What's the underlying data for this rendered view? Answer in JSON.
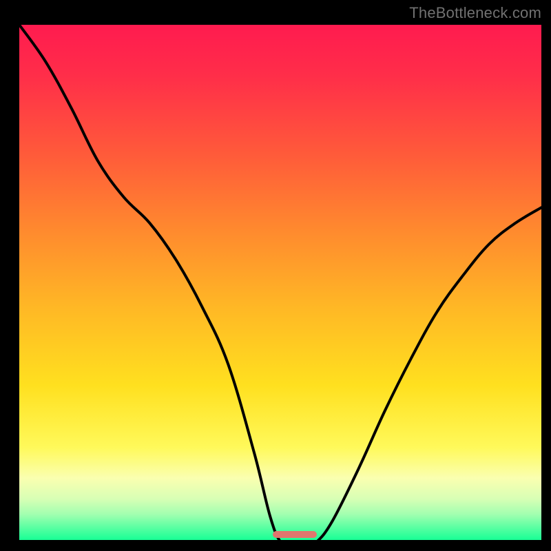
{
  "watermark": "TheBottleneck.com",
  "gradient": {
    "stops": [
      {
        "offset": "0%",
        "color": "#ff1b4f"
      },
      {
        "offset": "10%",
        "color": "#ff2e49"
      },
      {
        "offset": "25%",
        "color": "#ff5a3a"
      },
      {
        "offset": "40%",
        "color": "#ff8a2e"
      },
      {
        "offset": "55%",
        "color": "#ffb825"
      },
      {
        "offset": "70%",
        "color": "#ffe01f"
      },
      {
        "offset": "82%",
        "color": "#fff95a"
      },
      {
        "offset": "88%",
        "color": "#faffb0"
      },
      {
        "offset": "92%",
        "color": "#d8ffb5"
      },
      {
        "offset": "95%",
        "color": "#a2ffb0"
      },
      {
        "offset": "98%",
        "color": "#4effa0"
      },
      {
        "offset": "100%",
        "color": "#18ff95"
      }
    ]
  },
  "low_bar": {
    "left_pct": 48.5,
    "width_pct": 8.5,
    "color": "#e0766e"
  },
  "chart_data": {
    "type": "line",
    "title": "",
    "xlabel": "",
    "ylabel": "",
    "xlim": [
      0,
      100
    ],
    "ylim": [
      0,
      100
    ],
    "series": [
      {
        "name": "bottleneck-curve",
        "x": [
          0,
          5,
          10,
          15,
          20,
          25,
          30,
          35,
          40,
          45,
          48,
          50,
          52,
          55,
          57,
          60,
          65,
          70,
          75,
          80,
          85,
          90,
          95,
          100
        ],
        "y": [
          100,
          93,
          84,
          74,
          67,
          62,
          55,
          46,
          35,
          18,
          6,
          1,
          0.5,
          0.5,
          1,
          5,
          15,
          26,
          36,
          45,
          52,
          58,
          62,
          65
        ]
      }
    ],
    "annotations": [
      {
        "name": "optimal-zone",
        "x_start": 48.5,
        "x_end": 57,
        "y": 0
      }
    ]
  }
}
